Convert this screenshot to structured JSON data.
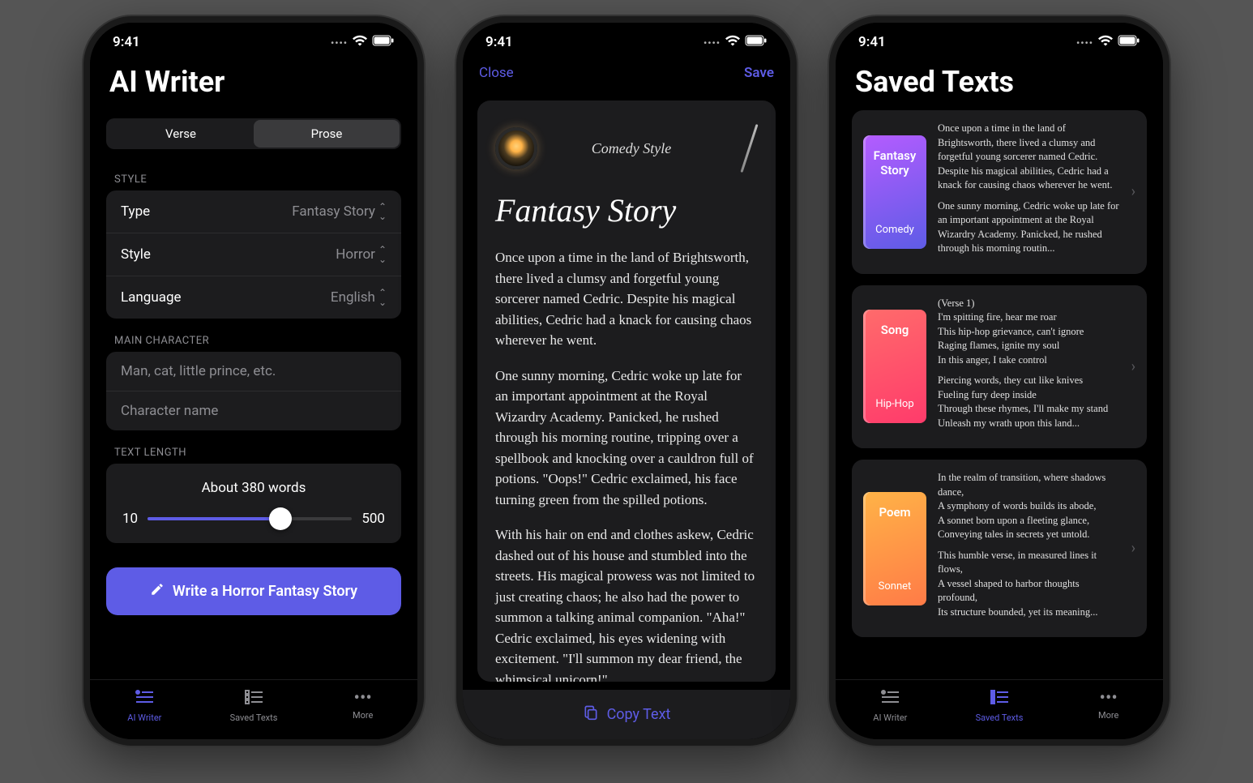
{
  "status": {
    "time": "9:41"
  },
  "screen1": {
    "title": "AI Writer",
    "segmented": {
      "verse": "Verse",
      "prose": "Prose"
    },
    "style_section": "STYLE",
    "rows": {
      "type_label": "Type",
      "type_value": "Fantasy Story",
      "style_label": "Style",
      "style_value": "Horror",
      "lang_label": "Language",
      "lang_value": "English"
    },
    "main_char_section": "MAIN CHARACTER",
    "placeholder1": "Man, cat, little prince, etc.",
    "placeholder2": "Character name",
    "length_section": "TEXT LENGTH",
    "slider_label": "About 380 words",
    "slider_min": "10",
    "slider_max": "500",
    "cta": "Write a Horror Fantasy Story",
    "tabs": {
      "ai": "AI Writer",
      "saved": "Saved Texts",
      "more": "More"
    }
  },
  "screen2": {
    "close": "Close",
    "save": "Save",
    "style_tag": "Comedy Style",
    "title": "Fantasy Story",
    "p1": "Once upon a time in the land of Brightsworth, there lived a clumsy and forgetful young sorcerer named Cedric. Despite his magical abilities, Cedric had a knack for causing chaos wherever he went.",
    "p2": "One sunny morning, Cedric woke up late for an important appointment at the Royal Wizardry Academy. Panicked, he rushed through his morning routine, tripping over a spellbook and knocking over a cauldron full of potions. \"Oops!\" Cedric exclaimed, his face turning green from the spilled potions.",
    "p3": "With his hair on end and clothes askew, Cedric dashed out of his house and stumbled into the streets. His magical prowess was not limited to just creating chaos; he also had the power to summon a talking animal companion. \"Aha!\" Cedric exclaimed, his eyes widening with excitement. \"I'll summon my dear friend, the whimsical unicorn!\"",
    "copy": "Copy Text"
  },
  "screen3": {
    "title": "Saved Texts",
    "items": [
      {
        "book_title": "Fantasy Story",
        "book_sub": "Comedy",
        "p1": "Once upon a time in the land of Brightsworth, there lived a clumsy and forgetful young sorcerer named Cedric. Despite his magical abilities, Cedric had a knack for causing chaos wherever he went.",
        "p2": "One sunny morning, Cedric woke up late for an important appointment at the Royal Wizardry Academy. Panicked, he rushed through his morning routin..."
      },
      {
        "book_title": "Song",
        "book_sub": "Hip-Hop",
        "p1": "(Verse 1)\nI'm spitting fire, hear me roar\nThis hip-hop grievance, can't ignore\nRaging flames, ignite my soul\nIn this anger, I take control",
        "p2": "Piercing words, they cut like knives\nFueling fury deep inside\nThrough these rhymes, I'll make my stand\nUnleash my wrath upon this land..."
      },
      {
        "book_title": "Poem",
        "book_sub": "Sonnet",
        "p1": "In the realm of transition, where shadows dance,\nA symphony of words builds its abode,\nA sonnet born upon a fleeting glance,\nConveying tales in secrets yet untold.",
        "p2": "This humble verse, in measured lines it flows,\nA vessel shaped to harbor thoughts profound,\nIts structure bounded, yet its meaning..."
      }
    ],
    "tabs": {
      "ai": "AI Writer",
      "saved": "Saved Texts",
      "more": "More"
    }
  }
}
